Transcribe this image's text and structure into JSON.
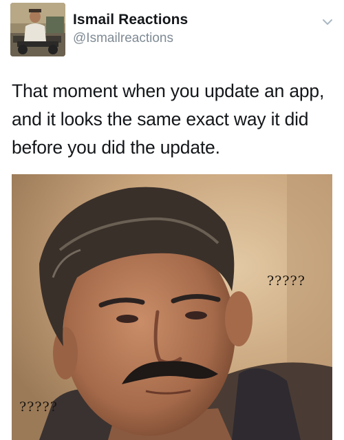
{
  "user": {
    "display_name": "Ismail Reactions",
    "handle": "@Ismailreactions"
  },
  "tweet": {
    "text": "That moment when you update an app, and it looks the same exact way it did before you did the update."
  },
  "media": {
    "caption_top_right": "?????",
    "caption_bottom_left": "?????"
  },
  "icons": {
    "menu": "chevron-down-icon",
    "avatar": "avatar"
  },
  "colors": {
    "name": "#14171a",
    "handle": "#7f8a94",
    "chevron": "#aab8c2"
  }
}
